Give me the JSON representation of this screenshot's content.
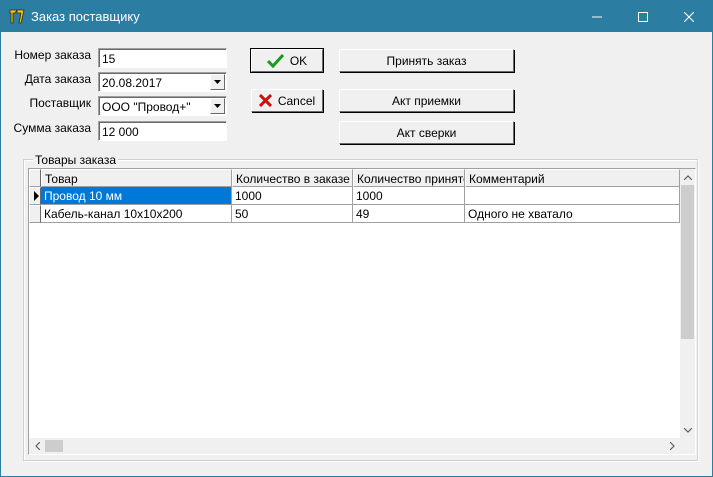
{
  "window": {
    "title": "Заказ поставщику"
  },
  "form": {
    "order_number": {
      "label": "Номер заказа",
      "value": "15"
    },
    "order_date": {
      "label": "Дата заказа",
      "value": "20.08.2017"
    },
    "supplier": {
      "label": "Поставщик",
      "value": "ООО \"Провод+\""
    },
    "order_sum": {
      "label": "Сумма заказа",
      "value": "12 000"
    }
  },
  "buttons": {
    "ok": "OK",
    "cancel": "Cancel",
    "accept_order": "Принять заказ",
    "acceptance_act": "Акт приемки",
    "reconciliation_act": "Акт сверки"
  },
  "goods": {
    "caption": "Товары заказа",
    "columns": [
      "Товар",
      "Количество в заказе",
      "Количество принято",
      "Комментарий"
    ],
    "rows": [
      {
        "product": "Провод 10 мм",
        "ordered": "1000",
        "accepted": "1000",
        "comment": ""
      },
      {
        "product": "Кабель-канал 10х10х200",
        "ordered": "50",
        "accepted": "49",
        "comment": "Одного не хватало"
      }
    ]
  },
  "colors": {
    "titlebar": "#2b7ea1",
    "selection": "#0078d7",
    "ok_check": "#1a9a1a",
    "cancel_x": "#cc1010"
  },
  "icons": [
    "app-icon",
    "minimize-icon",
    "maximize-icon",
    "close-icon",
    "check-icon",
    "cross-icon",
    "dropdown-arrow-icon",
    "row-pointer-icon",
    "scroll-up-icon",
    "scroll-down-icon",
    "scroll-left-icon",
    "scroll-right-icon"
  ]
}
